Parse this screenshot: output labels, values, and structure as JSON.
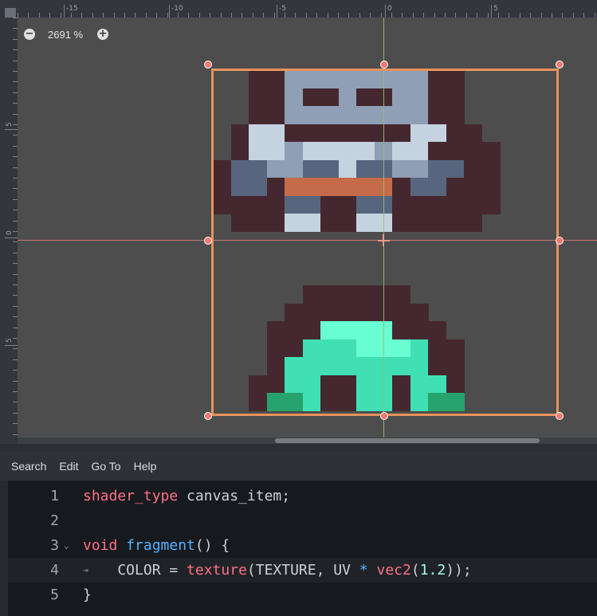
{
  "viewport": {
    "zoom_out_icon": "minus-circle-icon",
    "zoom_in_icon": "plus-circle-icon",
    "zoom_value": "2691 %",
    "ruler_top_labels": [
      "-15",
      "-10",
      "-5",
      "0",
      "5"
    ],
    "ruler_left_labels": [
      "5",
      "0",
      "5"
    ]
  },
  "menu": {
    "items": [
      "Search",
      "Edit",
      "Go To",
      "Help"
    ]
  },
  "editor": {
    "lines": [
      {
        "number": "1",
        "tokens": [
          {
            "text": "shader_type",
            "class": "kw"
          },
          {
            "text": " canvas_item;",
            "class": "pl"
          }
        ]
      },
      {
        "number": "2",
        "tokens": []
      },
      {
        "number": "3",
        "fold": "⌄",
        "tokens": [
          {
            "text": "void",
            "class": "kw"
          },
          {
            "text": " ",
            "class": "pl"
          },
          {
            "text": "fragment",
            "class": "fn"
          },
          {
            "text": "() {",
            "class": "pl"
          }
        ]
      },
      {
        "number": "4",
        "indent_marker": "⇥",
        "tokens": [
          {
            "text": "    COLOR = ",
            "class": "pl"
          },
          {
            "text": "texture",
            "class": "kw"
          },
          {
            "text": "(TEXTURE, UV ",
            "class": "pl"
          },
          {
            "text": "*",
            "class": "fn"
          },
          {
            "text": " ",
            "class": "pl"
          },
          {
            "text": "vec2",
            "class": "kw"
          },
          {
            "text": "(",
            "class": "pl"
          },
          {
            "text": "1.2",
            "class": "nm"
          },
          {
            "text": "));",
            "class": "pl"
          }
        ]
      },
      {
        "number": "5",
        "tokens": [
          {
            "text": "}",
            "class": "pl"
          }
        ]
      }
    ]
  },
  "colors": {
    "selection": "#e8925c",
    "handle": "#f07a72",
    "x_axis": "#d87a7a",
    "y_axis": "#8fc26a",
    "sprite_dark": "#45282f",
    "sprite_steel": "#8e9fb6",
    "sprite_light": "#c5d3e1",
    "sprite_slate": "#58657e",
    "sprite_rust": "#c66b49",
    "sprite_teal": "#40dfb4",
    "sprite_mint": "#6affd3",
    "sprite_green": "#27a36d"
  }
}
